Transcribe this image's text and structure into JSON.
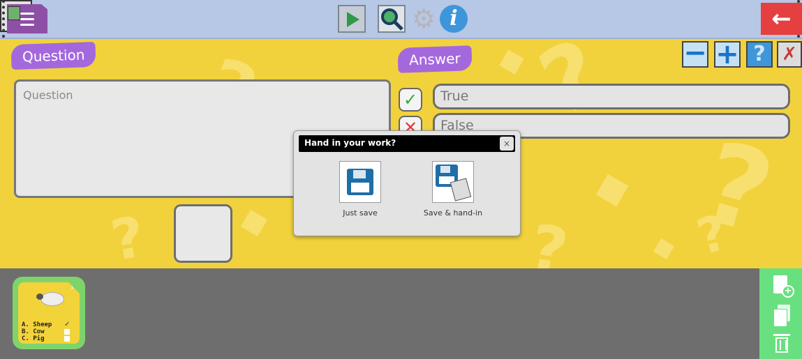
{
  "toolbar": {
    "menu_icon": "hamburger-menu-icon",
    "play_icon": "play-icon",
    "zoom_icon": "magnifier-icon",
    "settings_icon": "gear-icon",
    "info_label": "i",
    "film_icon": "film-icon",
    "back_icon": "arrow-left-icon",
    "back_label": "←"
  },
  "editor": {
    "question_tag": "Question",
    "answer_tag": "Answer",
    "question_placeholder": "Question",
    "answers": [
      {
        "text": "True",
        "status": "correct",
        "mark": "✓"
      },
      {
        "text": "False",
        "status": "wrong",
        "mark": "✕"
      }
    ],
    "controls": {
      "minus": "−",
      "plus": "+",
      "help": "?",
      "tool": "✗"
    }
  },
  "dialog": {
    "title": "Hand in your work?",
    "close": "×",
    "options": [
      {
        "label": "Just save",
        "icon": "floppy-disk-icon"
      },
      {
        "label": "Save & hand-in",
        "icon": "floppy-disk-handin-icon"
      }
    ]
  },
  "slides": {
    "thumbnail": {
      "number": "1",
      "options": [
        {
          "label": "A. Sheep",
          "checked": true,
          "mark": "✓"
        },
        {
          "label": "B. Cow",
          "checked": false
        },
        {
          "label": "C. Pig",
          "checked": false
        }
      ]
    },
    "side_actions": [
      "new-page-icon",
      "copy-icon",
      "trash-icon"
    ]
  },
  "colors": {
    "toolbar": "#b7c7e6",
    "work_area": "#f2d23c",
    "tag": "#a468dd",
    "bottom_panel": "#6e6e6e",
    "side_panel": "#68e080",
    "back_button": "#e53f3f"
  }
}
